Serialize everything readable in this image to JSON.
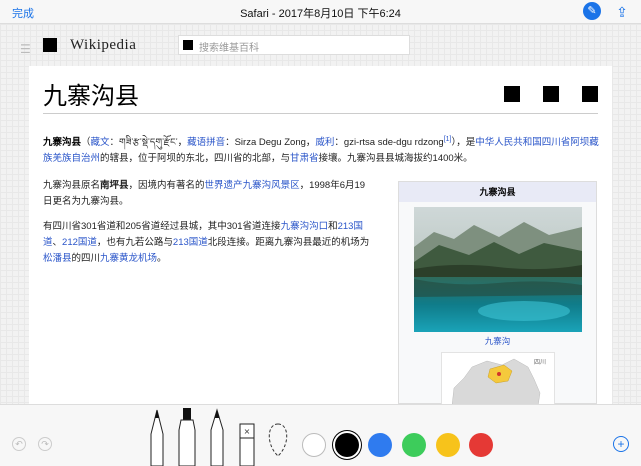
{
  "topbar": {
    "done_label": "完成",
    "title": "Safari - 2017年8月10日 下午6:24",
    "markup_icon": "pen-icon",
    "share_icon": "share-icon"
  },
  "wiki": {
    "wordmark": "Wikipedia",
    "search_placeholder": "搜索维基百科",
    "page_title": "九寨沟县",
    "lead": {
      "bold": "九寨沟县",
      "p1": "（",
      "tibetan_link": "藏文",
      "tibetan_text": "：གཟི་རྩ་སྡེ་དགུ་རྫོང་，",
      "pinyin_link": "藏语拼音",
      "pinyin_text": "：Sirza Degu Zong，",
      "wylie_link": "威利",
      "wylie_text": "：gzi-rtsa sde-dgu rdzong",
      "note": "[1]",
      "p2": "），是",
      "prc_link": "中华人民共和国四川省阿坝藏族羌族自治州",
      "p3": "的辖县，位于阿坝的东北，四川省的北部，与",
      "gansu_link": "甘肃省",
      "p4": "接壤。九寨沟县县城海拔约1400米。"
    },
    "para2": {
      "t1": "九寨沟县原名",
      "nanping": "南坪县",
      "t2": "，因境内有著名的",
      "heritage_link": "世界遗产",
      "jzg_link": "九寨沟风景区",
      "t3": "，1998年6月19日更名为九寨沟县。"
    },
    "para3": {
      "t1": "有四川省301省道和205省道经过县城，其中301省道连接",
      "jzg_kou_link": "九寨沟沟口",
      "t2": "和",
      "g213_link": "213国道",
      "sep": "、",
      "g212_link": "212国道",
      "t3": "，也有九若公路与",
      "g213b_link": "213国道",
      "t4": "北段连接。距离九寨沟县最近的机场为",
      "songpan_link": "松潘县",
      "t5": "的四川",
      "airport_link": "九寨黄龙机场",
      "t6": "。"
    },
    "infobox": {
      "title": "九寨沟县",
      "caption": "九寨沟",
      "map_label": "四川"
    }
  },
  "toolbar": {
    "undo_icon": "undo-icon",
    "redo_icon": "redo-icon",
    "add_icon": "add-icon",
    "colors": [
      "#ffffff",
      "#000000",
      "#2f7bef",
      "#3dcc5b",
      "#f7c31b",
      "#e53935"
    ]
  }
}
